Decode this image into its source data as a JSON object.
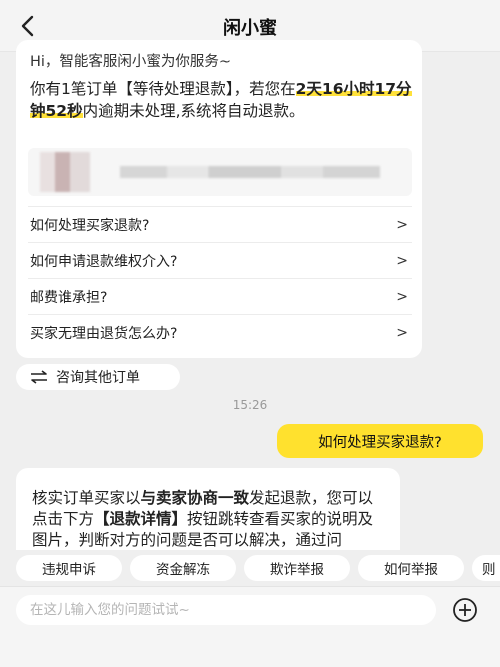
{
  "header": {
    "back_icon": "chevron-left-icon",
    "title": "闲小蜜"
  },
  "greeting": "Hi，智能客服闲小蜜为你服务~",
  "order_notice": {
    "part1": "你有1笔订单【等待处理退款】，若您在",
    "highlight_time": "2天16小时17分钟52秒",
    "part2": "内逾期未处理,系统将自动退款。"
  },
  "faq_items": [
    {
      "label": "如何处理买家退款?",
      "arrow": ">"
    },
    {
      "label": "如何申请退款维权介入?",
      "arrow": ">"
    },
    {
      "label": "邮费谁承担?",
      "arrow": ">"
    },
    {
      "label": "买家无理由退货怎么办?",
      "arrow": ">"
    }
  ],
  "consult_other": {
    "icon": "swap-icon",
    "label": "咨询其他订单"
  },
  "timestamp": "15:26",
  "user_message": "如何处理买家退款?",
  "bot_reply": {
    "t1": "核实订单买家以",
    "b1": "与卖家协商一致",
    "t2": "发起退款，您可以点击下方",
    "b2": "【退款详情】",
    "t3": "按钮跳转查看买家的说明及图片，判断对方的问题是否可以解决，通过问"
  },
  "quick_chips": [
    "违规申诉",
    "资金解冻",
    "欺诈举报",
    "如何举报",
    "则"
  ],
  "input": {
    "placeholder": "在这儿输入您的问题试试~",
    "plus_icon": "plus-circle-icon"
  },
  "colors": {
    "accent_yellow": "#ffe12e",
    "highlight_yellow": "#ffe13a",
    "background": "#efefef"
  }
}
